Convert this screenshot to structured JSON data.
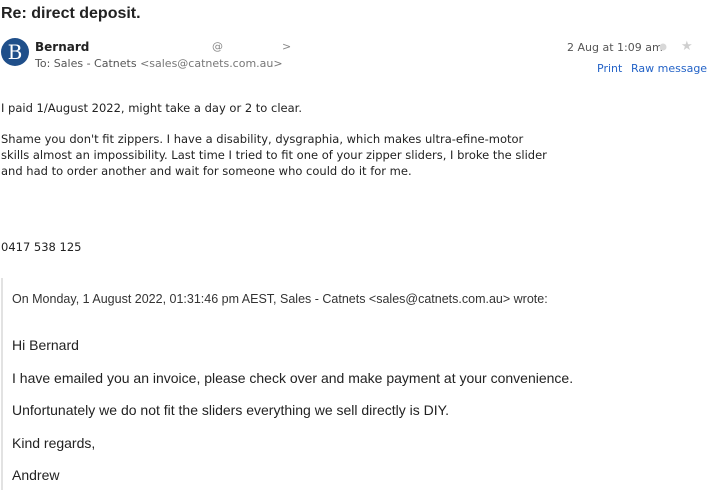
{
  "subject": "Re: direct deposit.",
  "sender": {
    "name": "Bernard",
    "at": "@",
    "chevron": ">",
    "to_prefix": "To:",
    "to_name": "Sales - Catnets",
    "to_email": "<sales@catnets.com.au>",
    "avatar_letter": "B"
  },
  "meta": {
    "date": "2 Aug at 1:09 am",
    "print": "Print",
    "raw": "Raw message"
  },
  "message": {
    "line1": "I paid 1/August 2022, might take a day or 2 to clear.",
    "para2_line1": "Shame you don't fit zippers. I have a disability, dysgraphia, which makes ultra-efine-motor",
    "para2_line2": "skills almost an impossibility. Last time I tried to fit one of your zipper sliders, I broke the slider",
    "para2_line3": "and had to order another and wait for someone who could do it for me.",
    "phone": "0417 538 125"
  },
  "quote": {
    "header": "On Monday, 1 August 2022, 01:31:46 pm AEST, Sales - Catnets <sales@catnets.com.au> wrote:",
    "greeting": "Hi Bernard",
    "line1": "I have emailed you an invoice, please check over and make payment at your convenience.",
    "line2": "Unfortunately we do not fit the sliders everything we sell directly is DIY.",
    "regards": "Kind regards,",
    "signoff": "Andrew"
  }
}
